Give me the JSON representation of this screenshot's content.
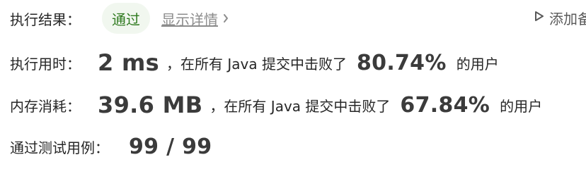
{
  "result": {
    "label": "执行结果：",
    "status": "通过",
    "details_link": "显示详情",
    "add_note": "添加备"
  },
  "runtime": {
    "label": "执行用时：",
    "value": "2 ms",
    "beat_text": "，在所有 Java 提交中击败了",
    "percent": "80.74%",
    "suffix": "的用户"
  },
  "memory": {
    "label": "内存消耗：",
    "value": "39.6 MB",
    "beat_text": "，在所有 Java 提交中击败了",
    "percent": "67.84%",
    "suffix": "的用户"
  },
  "tests": {
    "label": "通过测试用例：",
    "value": "99 / 99"
  },
  "colors": {
    "pass_text": "#2f7a1f",
    "pass_bg": "#f1f7ef",
    "muted": "#8c8c8c"
  },
  "icons": {
    "details": "chevron-right-icon",
    "add_note": "play-outline-icon"
  }
}
